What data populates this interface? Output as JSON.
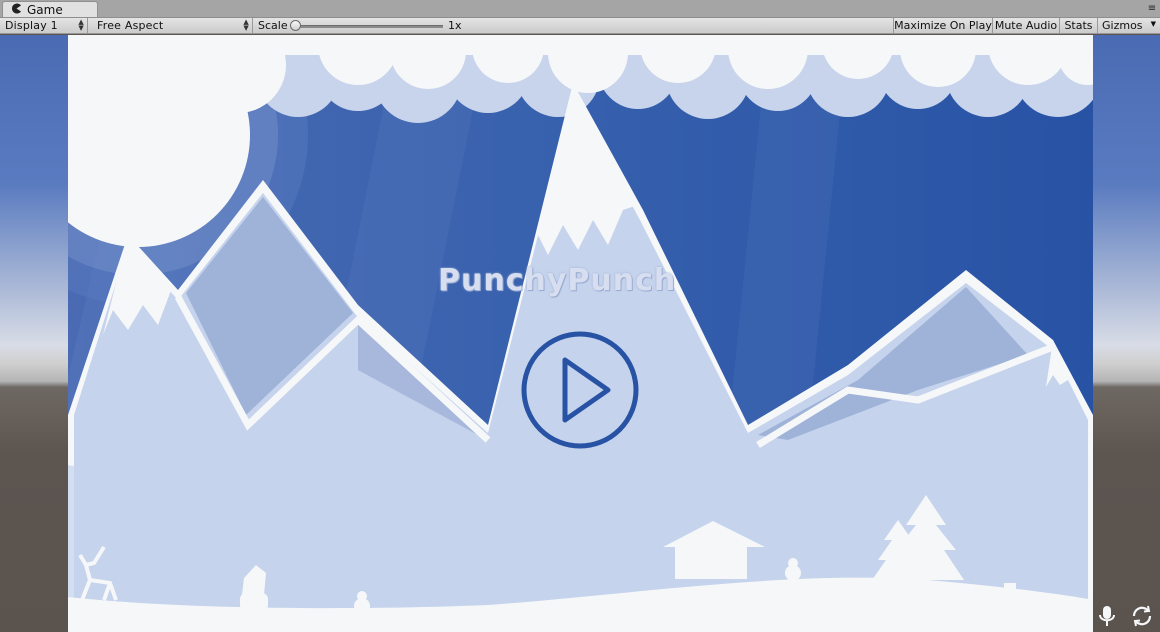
{
  "window": {
    "tab_label": "Game",
    "tab_icon": "pacman-game-icon",
    "menu_icon": "tab-menu-icon"
  },
  "toolbar": {
    "display_select": "Display 1",
    "aspect_select": "Free Aspect",
    "scale_label": "Scale",
    "scale_value": "1x",
    "scale_fraction": 0.0,
    "maximize_on_play": "Maximize On Play",
    "mute_audio": "Mute Audio",
    "stats": "Stats",
    "gizmos": "Gizmos"
  },
  "game": {
    "logo_text": "PunchyPunch",
    "play_icon": "play-icon",
    "colors": {
      "sky_dark": "#2b56a6",
      "sky_light": "#4a6bb3",
      "mountain": "#c5d3ec",
      "mountain_shade": "#9fb2d8",
      "snow": "#f6f7f9",
      "cloud_back": "#c8d4ec"
    }
  },
  "overlay": {
    "mic_icon": "microphone-icon",
    "refresh_icon": "refresh-icon"
  }
}
